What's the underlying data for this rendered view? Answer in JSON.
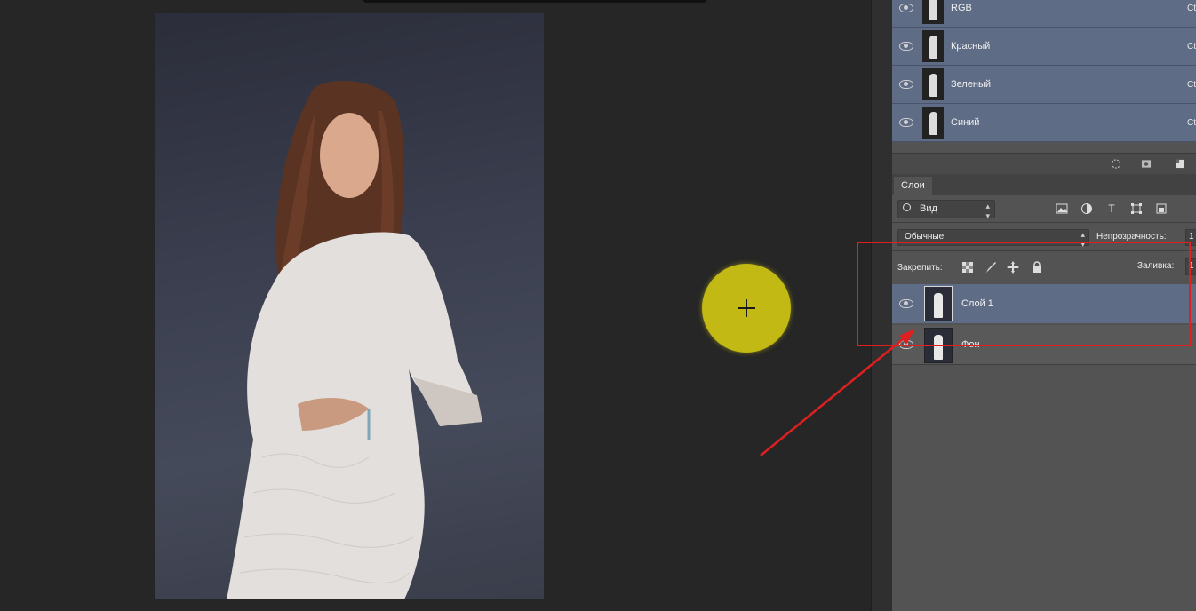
{
  "channels": [
    {
      "label": "RGB",
      "shortcut": "Ct"
    },
    {
      "label": "Красный",
      "shortcut": "Ct"
    },
    {
      "label": "Зеленый",
      "shortcut": "Ct"
    },
    {
      "label": "Синий",
      "shortcut": "Ct"
    }
  ],
  "layers_panel": {
    "tab_label": "Слои",
    "filter_label": "Вид",
    "blend_mode": "Обычные",
    "opacity_label": "Непрозрачность:",
    "opacity_value": "1",
    "lock_label": "Закрепить:",
    "fill_label": "Заливка:",
    "fill_value": "1",
    "layers": [
      {
        "name": "Слой 1",
        "selected": true
      },
      {
        "name": "Фон",
        "selected": false
      }
    ]
  },
  "colors": {
    "selection_blue": "#5f6c85",
    "cursor_yellow": "#c2b914",
    "annotation_red": "#e02020"
  }
}
